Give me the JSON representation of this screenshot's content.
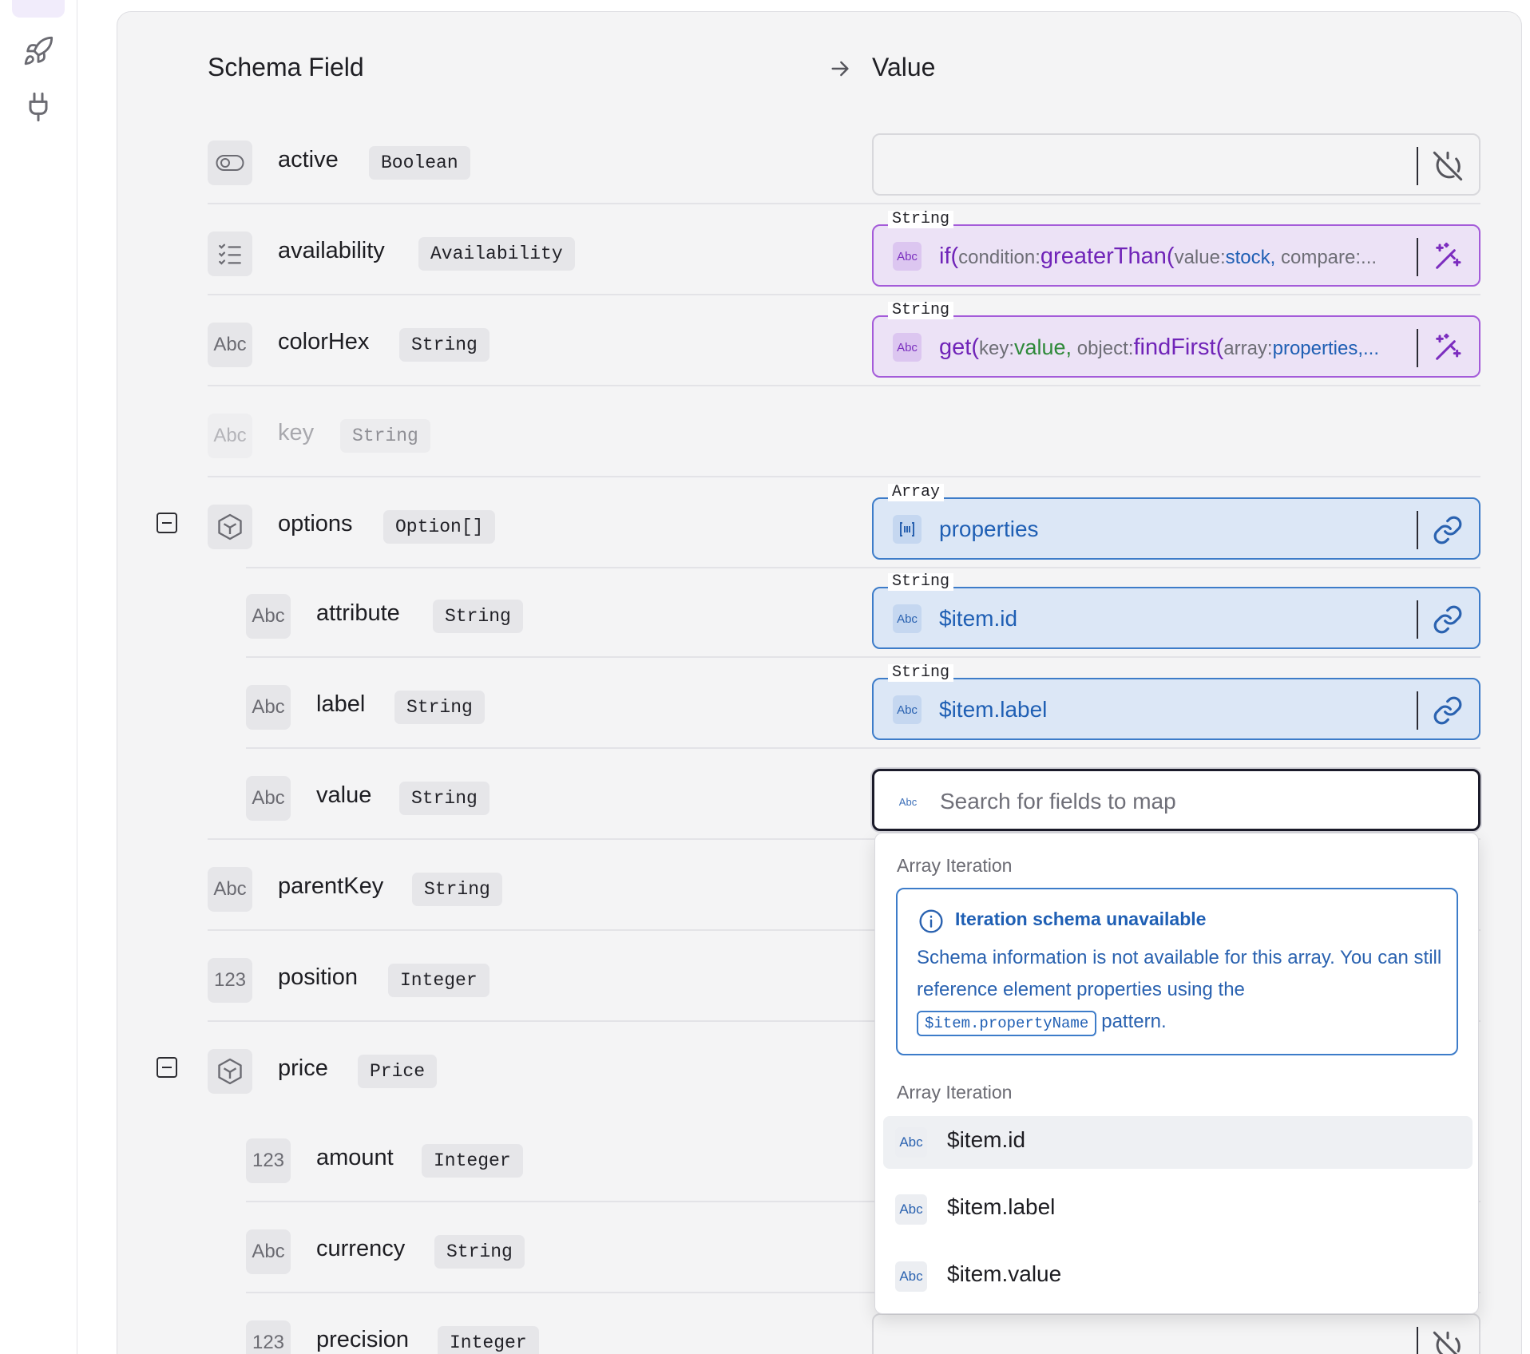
{
  "header": {
    "schema_field": "Schema Field",
    "value": "Value"
  },
  "rows": [
    {
      "name": "active",
      "type": "Boolean",
      "icon": "toggle-icon"
    },
    {
      "name": "availability",
      "type": "Availability",
      "icon": "checklist-icon",
      "value_label": "String",
      "value_text": {
        "fn1": "if(",
        "k1": "condition:",
        "fn2": "greaterThan(",
        "k2": "value:",
        "v2": "stock,",
        "k3": " compare:..."
      }
    },
    {
      "name": "colorHex",
      "type": "String",
      "icon": "Abc",
      "value_label": "String",
      "value_text": {
        "fn1": "get(",
        "k1": "key:",
        "v1": "value,",
        "k2": " object:",
        "fn2": "findFirst(",
        "k3": "array:",
        "v3": "properties,..."
      }
    },
    {
      "name": "key",
      "type": "String",
      "icon": "Abc"
    },
    {
      "name": "options",
      "type": "Option[]",
      "icon": "object-icon",
      "value_label": "Array",
      "value_text": "properties"
    },
    {
      "name": "attribute",
      "type": "String",
      "icon": "Abc",
      "value_label": "String",
      "value_text": "$item.id"
    },
    {
      "name": "label",
      "type": "String",
      "icon": "Abc",
      "value_label": "String",
      "value_text": "$item.label"
    },
    {
      "name": "value",
      "type": "String",
      "icon": "Abc",
      "search_placeholder": "Search for fields to map"
    },
    {
      "name": "parentKey",
      "type": "String",
      "icon": "Abc"
    },
    {
      "name": "position",
      "type": "Integer",
      "icon": "123"
    },
    {
      "name": "price",
      "type": "Price",
      "icon": "object-icon"
    },
    {
      "name": "amount",
      "type": "Integer",
      "icon": "123"
    },
    {
      "name": "currency",
      "type": "String",
      "icon": "Abc"
    },
    {
      "name": "precision",
      "type": "Integer",
      "icon": "123"
    }
  ],
  "chip_text": {
    "abc": "Abc",
    "num": "123"
  },
  "dropdown": {
    "section1": "Array Iteration",
    "info_title": "Iteration schema unavailable",
    "info_body": "Schema information is not available for this array. You can still reference element properties using the",
    "info_code": "$item.propertyName",
    "info_tail": "pattern.",
    "section2": "Array Iteration",
    "items": [
      "$item.id",
      "$item.label",
      "$item.value"
    ]
  },
  "colors": {
    "purple": "#a45bd9",
    "blue": "#3d7cc9",
    "focus": "#1b1b2a"
  }
}
